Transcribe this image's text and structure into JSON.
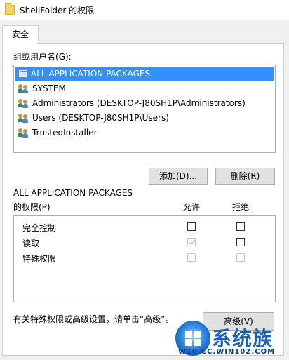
{
  "window": {
    "title": "ShellFolder 的权限"
  },
  "tabs": [
    {
      "label": "安全"
    }
  ],
  "groups": {
    "label": "组或用户名(G):",
    "items": [
      {
        "icon": "app-package-icon",
        "label": "ALL APPLICATION PACKAGES",
        "selected": true
      },
      {
        "icon": "users-icon",
        "label": "SYSTEM"
      },
      {
        "icon": "users-icon",
        "label": "Administrators (DESKTOP-J80SH1P\\Administrators)"
      },
      {
        "icon": "users-icon",
        "label": "Users (DESKTOP-J80SH1P\\Users)"
      },
      {
        "icon": "users-icon",
        "label": "TrustedInstaller"
      }
    ]
  },
  "buttons": {
    "add": "添加(D)...",
    "remove": "删除(R)",
    "advanced": "高级(V)"
  },
  "permissions": {
    "heading_line1": "ALL APPLICATION PACKAGES",
    "heading_line2": "的权限(P)",
    "allow_label": "允许",
    "deny_label": "拒绝",
    "rows": [
      {
        "name": "完全控制",
        "allow": false,
        "deny": false,
        "disabled": false
      },
      {
        "name": "读取",
        "allow": true,
        "deny": false,
        "disabled": false,
        "allow_disabled": true
      },
      {
        "name": "特殊权限",
        "allow": false,
        "deny": false,
        "disabled": true
      }
    ]
  },
  "footer": {
    "text": "有关特殊权限或高级设置，请单击“高级”。"
  },
  "watermark": {
    "brand": "系统族",
    "url": "W10.CC.WIN10Z.COM"
  }
}
